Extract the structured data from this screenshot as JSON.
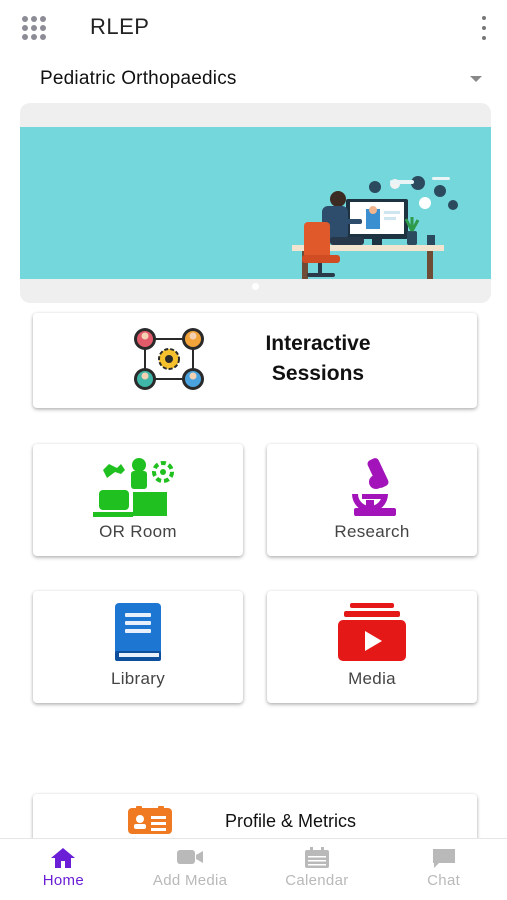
{
  "app": {
    "title": "RLEP"
  },
  "specialty": {
    "selected": "Pediatric Orthopaedics"
  },
  "interactive": {
    "label": "Interactive\nSessions"
  },
  "tiles": [
    {
      "label": "OR Room",
      "icon": "operating-room-icon",
      "color": "#1fc01f"
    },
    {
      "label": "Research",
      "icon": "microscope-icon",
      "color": "#a214b9"
    },
    {
      "label": "Library",
      "icon": "book-icon",
      "color": "#1d76d2"
    },
    {
      "label": "Media",
      "icon": "youtube-stack-icon",
      "color": "#e51818"
    }
  ],
  "profile": {
    "label": "Profile & Metrics",
    "icon": "id-card-icon",
    "color": "#ef7a22"
  },
  "bottom_nav": [
    {
      "label": "Home",
      "icon": "home-icon",
      "active": true
    },
    {
      "label": "Add Media",
      "icon": "video-camera-icon",
      "active": false
    },
    {
      "label": "Calendar",
      "icon": "calendar-icon",
      "active": false
    },
    {
      "label": "Chat",
      "icon": "chat-bubble-icon",
      "active": false
    }
  ],
  "colors": {
    "accent": "#6a1fd6",
    "banner_bg": "#73d7db",
    "inactive_nav": "#b9b9b9"
  }
}
